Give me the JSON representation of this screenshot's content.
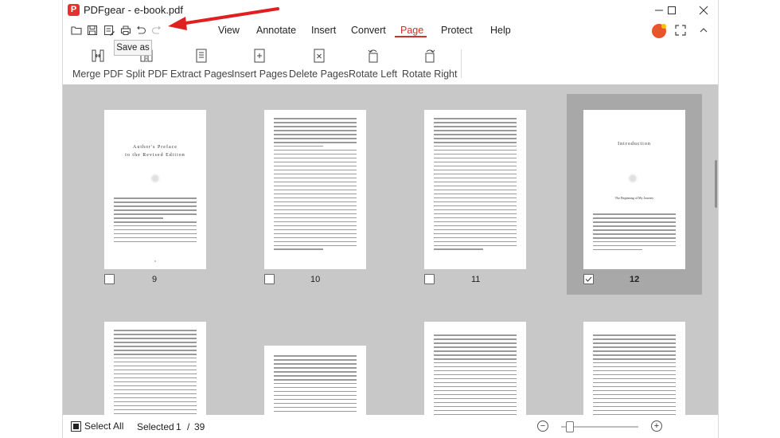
{
  "app": {
    "title": "PDFgear - e-book.pdf",
    "logo_letter": "P",
    "accent_color": "#d4302b"
  },
  "quick_access": {
    "icons": [
      "folder-icon",
      "save-icon",
      "save-as-icon",
      "print-icon",
      "undo-icon",
      "redo-icon"
    ],
    "tooltip": "Save as"
  },
  "menu": {
    "items": [
      {
        "label": "View"
      },
      {
        "label": "Annotate"
      },
      {
        "label": "Insert"
      },
      {
        "label": "Convert"
      },
      {
        "label": "Page",
        "active": true
      },
      {
        "label": "Protect"
      },
      {
        "label": "Help"
      }
    ]
  },
  "toolbar": {
    "tools": [
      {
        "label": "Merge PDF",
        "icon": "merge-icon"
      },
      {
        "label": "Split PDF",
        "icon": "split-icon"
      },
      {
        "label": "Extract Pages",
        "icon": "extract-icon"
      },
      {
        "label": "Insert Pages",
        "icon": "insert-page-icon"
      },
      {
        "label": "Delete Pages",
        "icon": "delete-page-icon"
      },
      {
        "label": "Rotate Left",
        "icon": "rotate-left-icon"
      },
      {
        "label": "Rotate Right",
        "icon": "rotate-right-icon"
      }
    ]
  },
  "pages": [
    {
      "number": "9",
      "selected": false
    },
    {
      "number": "10",
      "selected": false
    },
    {
      "number": "11",
      "selected": false
    },
    {
      "number": "12",
      "selected": true
    }
  ],
  "status": {
    "select_all": "Select All",
    "selected_label": "Selected",
    "selected_count": "1",
    "separator": "/",
    "total_pages": "39",
    "zoom_out": "−",
    "zoom_in": "+"
  }
}
